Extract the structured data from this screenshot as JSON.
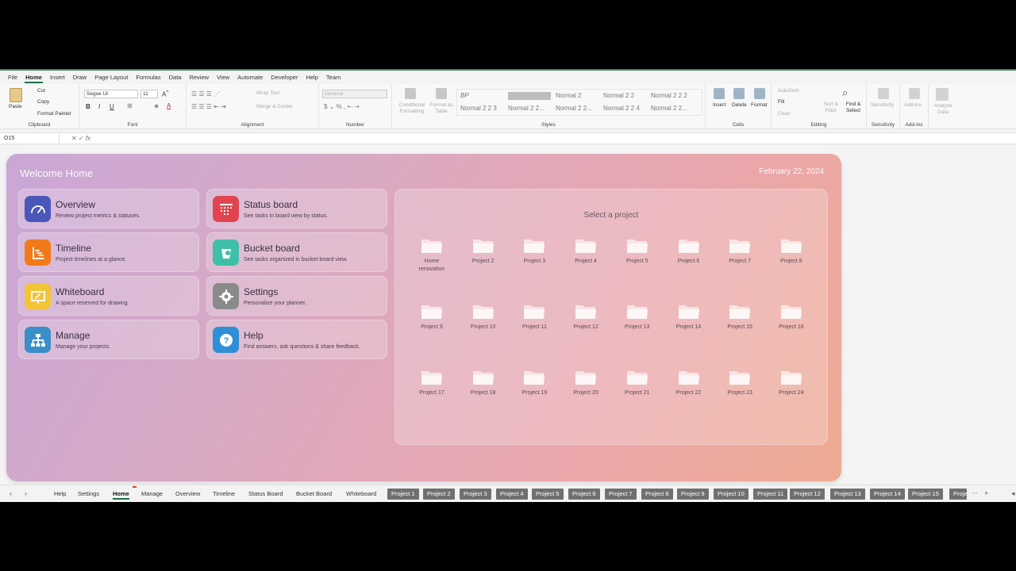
{
  "menu_tabs": [
    "File",
    "Home",
    "Insert",
    "Draw",
    "Page Layout",
    "Formulas",
    "Data",
    "Review",
    "View",
    "Automate",
    "Developer",
    "Help",
    "Team"
  ],
  "active_menu_tab": "Home",
  "ribbon": {
    "clipboard": {
      "paste": "Paste",
      "cut": "Cut",
      "copy": "Copy",
      "format_painter": "Format Painter",
      "label": "Clipboard"
    },
    "font": {
      "name": "Segoe UI",
      "size": "11",
      "label": "Font"
    },
    "alignment": {
      "wrap": "Wrap Text",
      "merge": "Merge & Center",
      "label": "Alignment"
    },
    "number": {
      "format": "General",
      "label": "Number"
    },
    "styles": {
      "conditional": "Conditional Formatting",
      "format_table": "Format as Table",
      "cells": [
        "BP",
        "",
        "Normal 2",
        "Normal 2 2",
        "Normal 2 2 2",
        "Normal 2 2 3",
        "Normal 2 2...",
        "Normal 2 2...",
        "Normal 2 2 4",
        "Normal 2 2..."
      ],
      "label": "Styles"
    },
    "cells": {
      "insert": "Insert",
      "delete": "Delete",
      "format": "Format",
      "label": "Cells"
    },
    "editing": {
      "autosum": "AutoSum",
      "fill": "Fill",
      "clear": "Clear",
      "sort": "Sort & Filter",
      "find": "Find & Select",
      "label": "Editing"
    },
    "sensitivity": {
      "btn": "Sensitivity",
      "label": "Sensitivity"
    },
    "addins": {
      "btn": "Add-ins",
      "label": "Add-ins"
    },
    "analyze": {
      "btn": "Analyze Data"
    }
  },
  "formula_bar": {
    "name_box": "O15",
    "fx": "fx"
  },
  "dashboard": {
    "welcome": "Welcome Home",
    "date": "February 22, 2024",
    "cards": [
      {
        "title": "Overview",
        "subtitle": "Review project metrics & statuses.",
        "icon": "gauge-icon",
        "color": "#4b57b8"
      },
      {
        "title": "Status board",
        "subtitle": "See tasks in board view by status.",
        "icon": "board-icon",
        "color": "#e0454f"
      },
      {
        "title": "Timeline",
        "subtitle": "Project timelines at a glance.",
        "icon": "timeline-icon",
        "color": "#f07a1a"
      },
      {
        "title": "Bucket board",
        "subtitle": "See tasks organized in bucket board view.",
        "icon": "bucket-icon",
        "color": "#3fbfa8"
      },
      {
        "title": "Whiteboard",
        "subtitle": "A space reserved for drawing.",
        "icon": "whiteboard-icon",
        "color": "#f2c437"
      },
      {
        "title": "Settings",
        "subtitle": "Personalize your planner.",
        "icon": "gear-icon",
        "color": "#8a8a8a"
      },
      {
        "title": "Manage",
        "subtitle": "Manage your projects.",
        "icon": "hierarchy-icon",
        "color": "#3a8fc9"
      },
      {
        "title": "Help",
        "subtitle": "Find answers, ask questions & share feedback.",
        "icon": "question-icon",
        "color": "#2f8fd6"
      }
    ],
    "select_project": "Select a project",
    "projects": [
      "Home renovation",
      "Project 2",
      "Project 3",
      "Project 4",
      "Project 5",
      "Project 6",
      "Project 7",
      "Project 8",
      "Project 9",
      "Project 10",
      "Project 11",
      "Project 12",
      "Project 13",
      "Project 14",
      "Project 15",
      "Project 16",
      "Project 17",
      "Project 18",
      "Project 19",
      "Project 20",
      "Project 21",
      "Project 22",
      "Project 23",
      "Project 24"
    ]
  },
  "sheet_tabs": {
    "plain": [
      "Help",
      "Settings",
      "Home",
      "Manage",
      "Overview",
      "Timeline",
      "Status Board",
      "Bucket Board",
      "Whiteboard"
    ],
    "active": "Home",
    "projects": [
      "Project 1",
      "Project 2",
      "Project 3",
      "Project 4",
      "Project 5",
      "Project 6",
      "Project 7",
      "Project 8",
      "Project 9",
      "Project 10",
      "Project 11",
      "Project 12",
      "Project 13",
      "Project 14",
      "Project 15",
      "Proje"
    ]
  }
}
